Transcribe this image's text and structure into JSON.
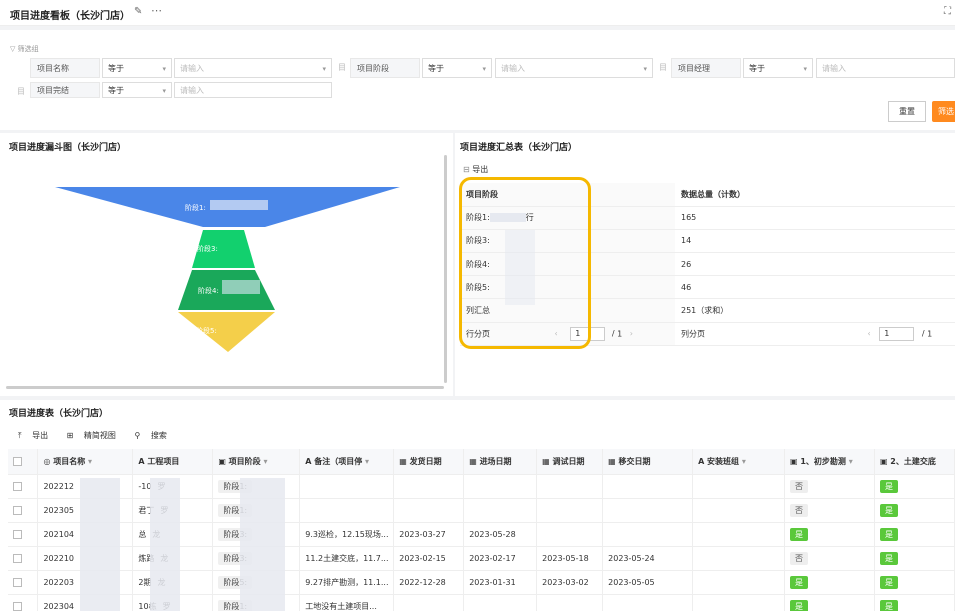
{
  "page": {
    "title": "项目进度看板（长沙门店）"
  },
  "filter": {
    "head": "筛选组",
    "rows": [
      {
        "label": "项目名称",
        "op": "等于",
        "placeholder": "请输入"
      },
      {
        "label": "项目阶段",
        "op": "等于",
        "placeholder": "请输入"
      },
      {
        "label": "项目经理",
        "op": "等于",
        "placeholder": "请输入"
      },
      {
        "label": "项目完结",
        "op": "等于",
        "placeholder": "请输入"
      }
    ],
    "reset": "重置",
    "search": "筛选"
  },
  "funnel": {
    "title": "项目进度漏斗图（长沙门店）",
    "labels": [
      "阶段1:",
      "阶段3:",
      "阶段4:",
      "阶段5:"
    ]
  },
  "summary": {
    "title": "项目进度汇总表（长沙门店）",
    "export": "导出",
    "headers": [
      "项目阶段",
      "数据总量（计数）"
    ],
    "rows": [
      {
        "stage": "阶段1:",
        "suffix": "行",
        "count": "165"
      },
      {
        "stage": "阶段3:",
        "suffix": "",
        "count": "14"
      },
      {
        "stage": "阶段4:",
        "suffix": "",
        "count": "26"
      },
      {
        "stage": "阶段5:",
        "suffix": "",
        "count": "46"
      },
      {
        "stage": "列汇总",
        "suffix": "",
        "count": "251（求和）"
      }
    ],
    "row_pager": {
      "label": "行分页",
      "page": "1",
      "total": "1"
    },
    "col_pager": {
      "label": "列分页",
      "page": "1",
      "total": "1"
    }
  },
  "table": {
    "title": "项目进度表（长沙门店）",
    "toolbar": {
      "export": "导出",
      "compact": "精简视图",
      "search": "搜索"
    },
    "headers": [
      "项目名称",
      "工程项目",
      "项目阶段",
      "备注（项目停",
      "发货日期",
      "进场日期",
      "调试日期",
      "移交日期",
      "安装班组",
      "1、初步勘测",
      "2、土建交底"
    ],
    "rows": [
      {
        "name": "202212",
        "code": "-10",
        "mgr": "罗",
        "stage": "阶段1:",
        "stage_sfx": "",
        "note": "",
        "ship": "",
        "enter": "",
        "debug": "",
        "handover": "",
        "team": "",
        "survey": "否",
        "civil": "是"
      },
      {
        "name": "202305",
        "code": "君丁",
        "mgr": "罗",
        "stage": "阶段1:",
        "stage_sfx": "",
        "note": "",
        "ship": "",
        "enter": "",
        "debug": "",
        "handover": "",
        "team": "",
        "survey": "否",
        "civil": "是"
      },
      {
        "name": "202104",
        "code": "总",
        "mgr": "龙",
        "stage": "阶段3:",
        "stage_sfx": "",
        "note": "9.3巡检，12.15现场...",
        "ship": "2023-03-27",
        "enter": "2023-05-28",
        "debug": "",
        "handover": "",
        "team": "",
        "survey": "是",
        "civil": "是"
      },
      {
        "name": "202210",
        "code": "炼路",
        "mgr": "龙",
        "stage": "阶段3:",
        "stage_sfx": "",
        "note": "11.2土建交底，11.7...",
        "ship": "2023-02-15",
        "enter": "2023-02-17",
        "debug": "2023-05-18",
        "handover": "2023-05-24",
        "team": "",
        "survey": "否",
        "civil": "是"
      },
      {
        "name": "202203",
        "code": "2期",
        "mgr": "龙",
        "stage": "阶段5:",
        "stage_sfx": "",
        "note": "9.27排产勘测，11.1...",
        "ship": "2022-12-28",
        "enter": "2023-01-31",
        "debug": "2023-03-02",
        "handover": "2023-05-05",
        "team": "",
        "survey": "是",
        "civil": "是"
      },
      {
        "name": "202304",
        "code": "10栋",
        "mgr": "罗",
        "stage": "阶段1:",
        "stage_sfx": "",
        "note": "工地没有土建项目...",
        "ship": "",
        "enter": "",
        "debug": "",
        "handover": "",
        "team": "",
        "survey": "是",
        "civil": "是"
      }
    ]
  },
  "colors": {
    "accent": "#ff8a1f",
    "funnel_1": "#4a86e8",
    "funnel_2": "#12d06e",
    "funnel_3": "#1aa85a",
    "funnel_4": "#f4cf4a",
    "highlight": "#f5b800",
    "yes": "#5ac83b"
  }
}
